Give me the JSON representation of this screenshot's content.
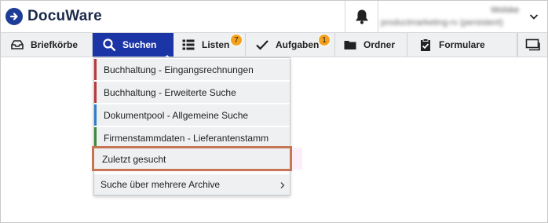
{
  "app": {
    "logo_text": "DocuWare",
    "brand_color": "#1c35a6"
  },
  "header": {
    "user_name": "Wolske",
    "user_context": "productmarketing-rv (persistent)"
  },
  "toolbar": {
    "items": [
      {
        "label": "Briefkörbe",
        "icon": "tray-icon"
      },
      {
        "label": "Suchen",
        "icon": "search-icon",
        "active": true
      },
      {
        "label": "Listen",
        "icon": "list-icon",
        "badge": "7"
      },
      {
        "label": "Aufgaben",
        "icon": "checkmark-icon",
        "badge": "1"
      },
      {
        "label": "Ordner",
        "icon": "folder-icon"
      },
      {
        "label": "Formulare",
        "icon": "clipboard-icon"
      }
    ]
  },
  "search_menu": {
    "items": [
      {
        "label": "Buchhaltung - Eingangsrechnungen",
        "color": "#b9393c"
      },
      {
        "label": "Buchhaltung - Erweiterte Suche",
        "color": "#b9393c"
      },
      {
        "label": "Dokumentpool - Allgemeine Suche",
        "color": "#2f7fc8"
      },
      {
        "label": "Firmenstammdaten - Lieferantenstamm",
        "color": "#3f8a3c"
      }
    ],
    "recent_label": "Zuletzt gesucht",
    "multi_archive_label": "Suche über mehrere Archive"
  }
}
